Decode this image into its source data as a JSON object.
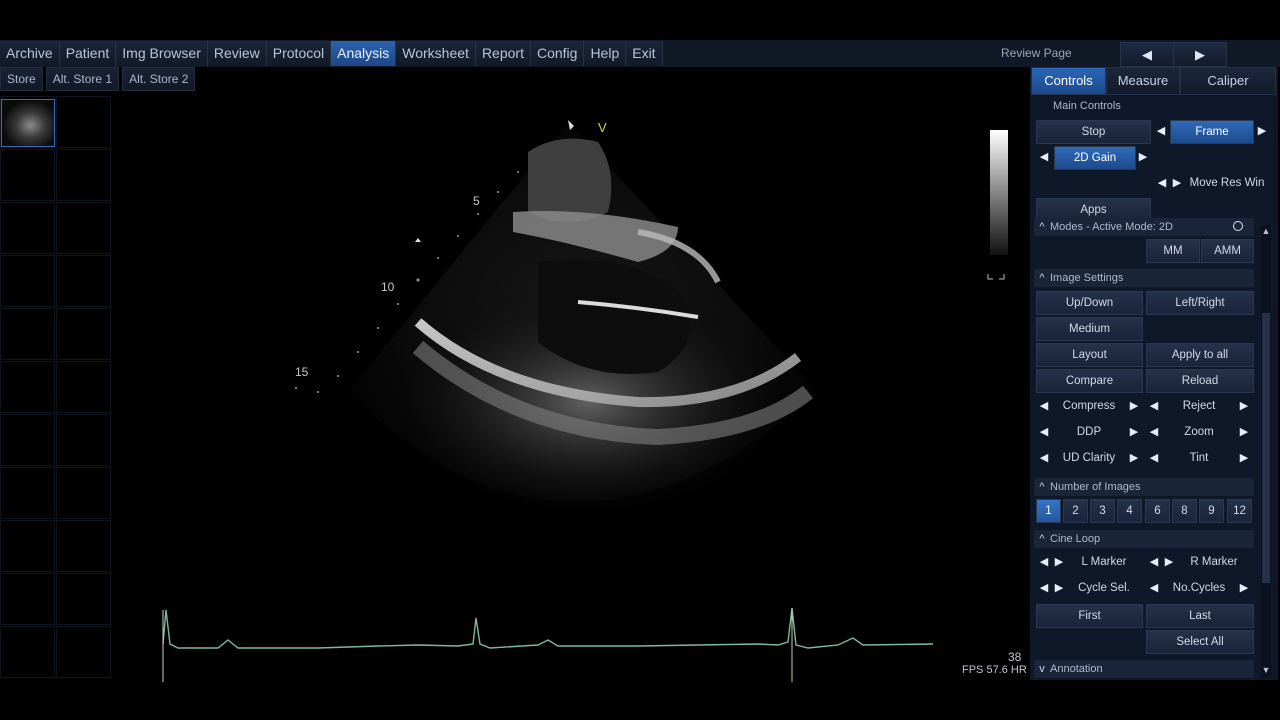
{
  "menu": {
    "items": [
      "Archive",
      "Patient",
      "Img Browser",
      "Review",
      "Protocol",
      "Analysis",
      "Worksheet",
      "Report",
      "Config",
      "Help",
      "Exit"
    ],
    "active": "Analysis"
  },
  "review_page": {
    "label": "Review Page",
    "prev": "◀",
    "next": "▶"
  },
  "store_bar": {
    "items": [
      "Store",
      "Alt. Store 1",
      "Alt. Store 2"
    ]
  },
  "image": {
    "depth_markers": [
      "5",
      "10",
      "15"
    ],
    "view_marker": "V",
    "heart_rate": "38",
    "fps_label": "FPS 57.6 HR"
  },
  "panel": {
    "tabs": [
      "Controls",
      "Measure",
      "Caliper"
    ],
    "active_tab": "Controls",
    "main_controls": {
      "title": "Main Controls",
      "stop": "Stop",
      "frame": "Frame",
      "gain_2d": "2D Gain",
      "move_res_win": "Move Res Win",
      "apps": "Apps"
    },
    "modes": {
      "title": "Modes - Active Mode: 2D",
      "mm": "MM",
      "amm": "AMM"
    },
    "image_settings": {
      "title": "Image Settings",
      "up_down": "Up/Down",
      "left_right": "Left/Right",
      "medium": "Medium",
      "layout": "Layout",
      "apply_to_all": "Apply to all",
      "compare": "Compare",
      "reload": "Reload",
      "compress": "Compress",
      "reject": "Reject",
      "ddp": "DDP",
      "zoom": "Zoom",
      "ud_clarity": "UD Clarity",
      "tint": "Tint"
    },
    "number_of_images": {
      "title": "Number of Images",
      "options": [
        "1",
        "2",
        "3",
        "4",
        "6",
        "8",
        "9",
        "12"
      ],
      "selected": "1"
    },
    "cine_loop": {
      "title": "Cine Loop",
      "l_marker": "L Marker",
      "r_marker": "R Marker",
      "cycle_sel": "Cycle Sel.",
      "no_cycles": "No.Cycles",
      "first": "First",
      "last": "Last",
      "select_all": "Select All"
    },
    "annotation": {
      "title": "Annotation"
    }
  },
  "colors": {
    "accent": "#2b66b8",
    "ecg_trace": "#7fb8a6",
    "view_marker": "#d8d830"
  }
}
